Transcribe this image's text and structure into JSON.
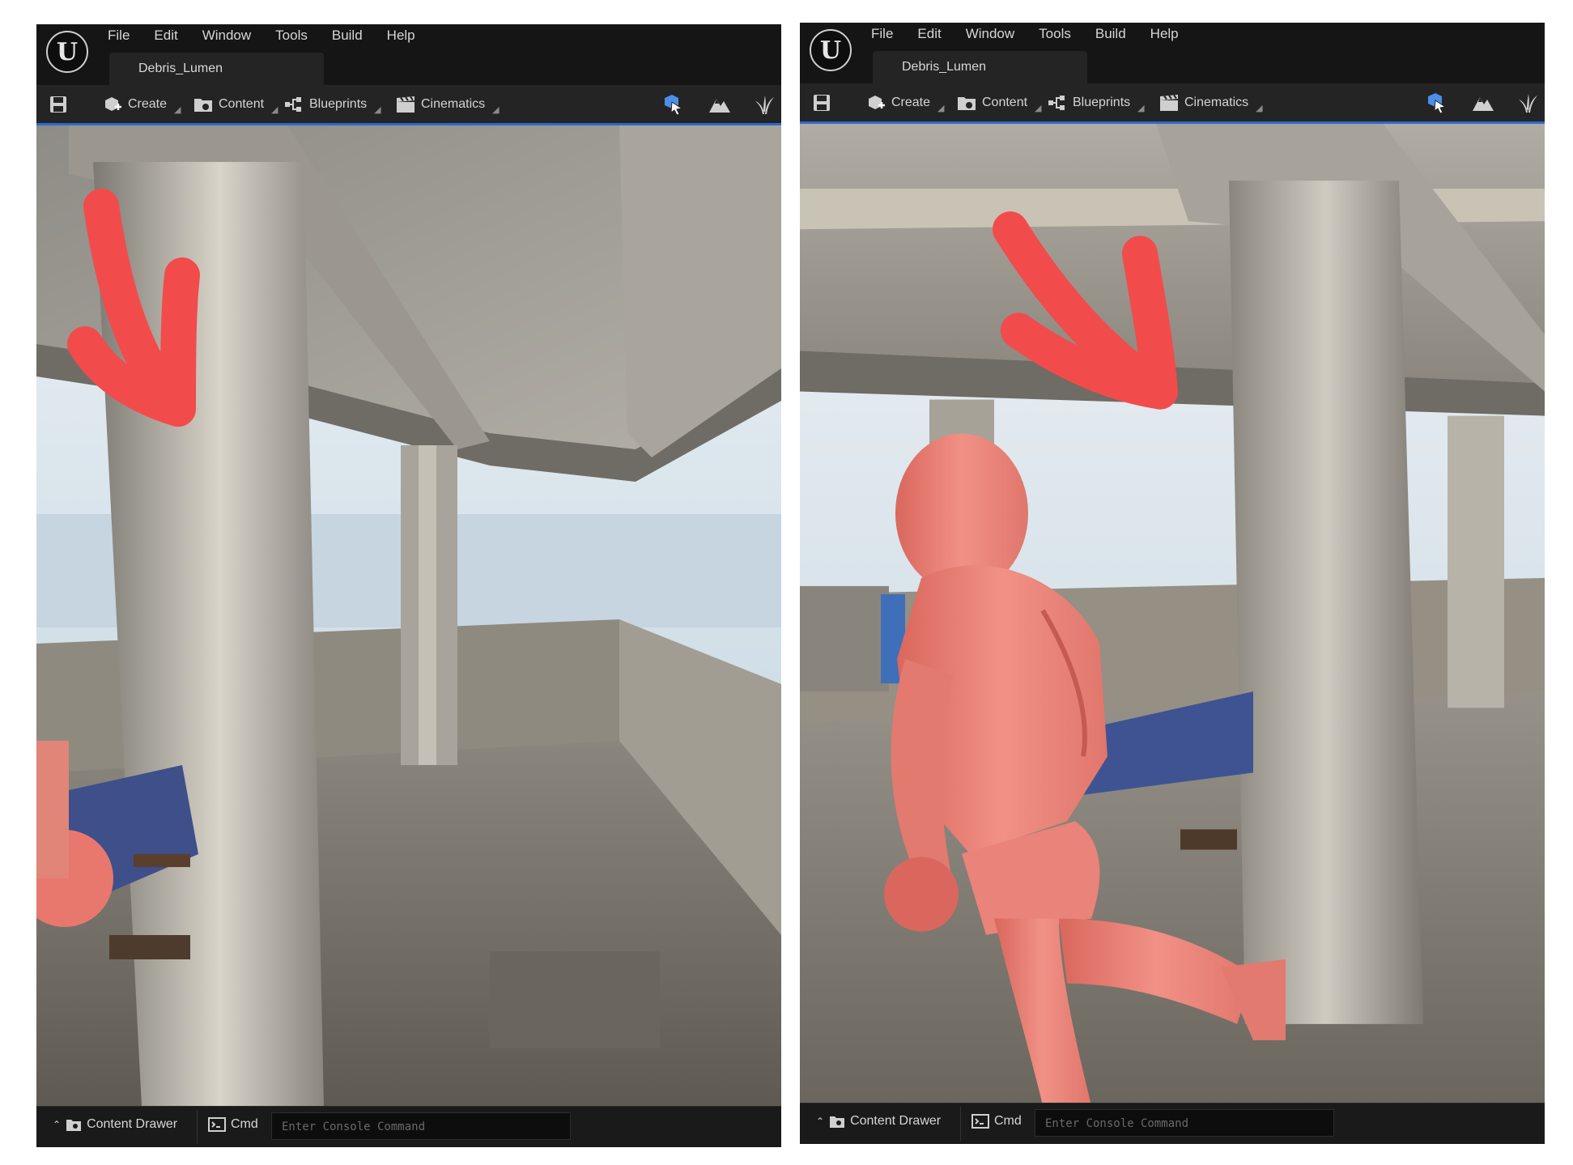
{
  "app": {
    "logo_text": "U"
  },
  "menu": [
    "File",
    "Edit",
    "Window",
    "Tools",
    "Build",
    "Help"
  ],
  "level_tab": "Debris_Lumen",
  "toolbar": {
    "create": "Create",
    "content": "Content",
    "blueprints": "Blueprints",
    "cinematics": "Cinematics"
  },
  "bottom": {
    "content_drawer": "Content Drawer",
    "cmd": "Cmd",
    "console_placeholder": "Enter Console Command"
  },
  "colors": {
    "accent": "#2a6cd0",
    "annotation_arrow": "#f24b4b",
    "mannequin": "#e8786e"
  }
}
